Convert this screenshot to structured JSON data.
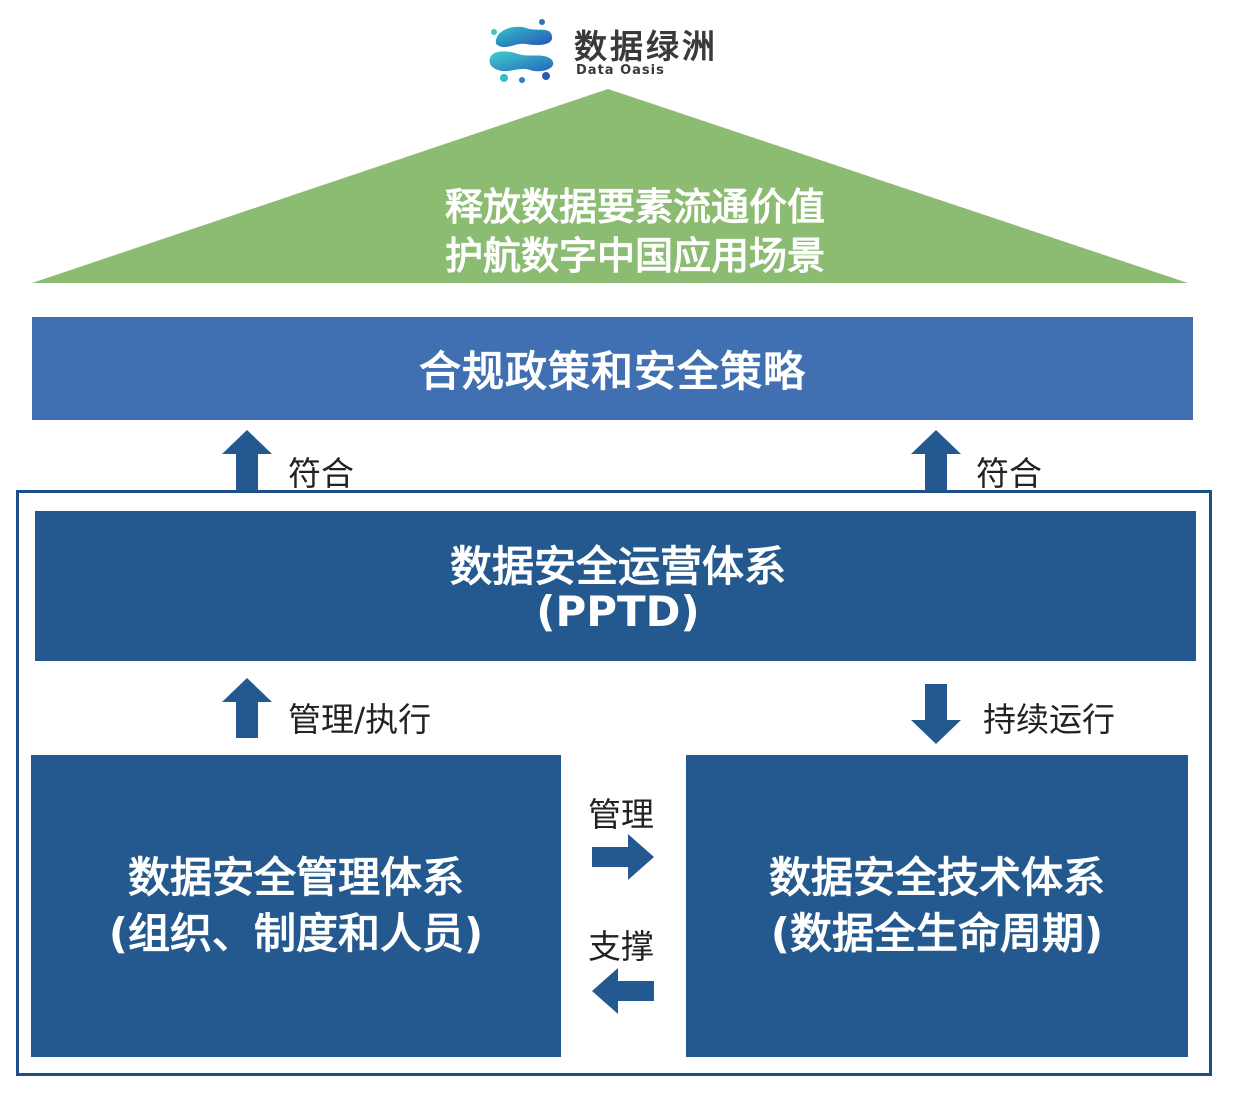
{
  "logo": {
    "title": "数据绿洲",
    "subtitle": "Data Oasis"
  },
  "roof": {
    "line1": "释放数据要素流通价值",
    "line2": "护航数字中国应用场景",
    "color": "#8cbb72"
  },
  "policy": {
    "label": "合规政策和安全策略",
    "color": "#4070b1"
  },
  "connectors": {
    "left_up": "符合",
    "right_up": "符合",
    "manage_execute": "管理/执行",
    "continuous_run": "持续运行",
    "manage": "管理",
    "support": "支撑"
  },
  "operations": {
    "title": "数据安全运营体系",
    "subtitle": "(PPTD)",
    "color": "#23598e"
  },
  "management_system": {
    "title": "数据安全管理体系",
    "subtitle": "(组织、制度和人员)"
  },
  "technical_system": {
    "title": "数据安全技术体系",
    "subtitle": "(数据全生命周期)"
  },
  "colors": {
    "arrow": "#23598e",
    "frame": "#1e4f86"
  }
}
